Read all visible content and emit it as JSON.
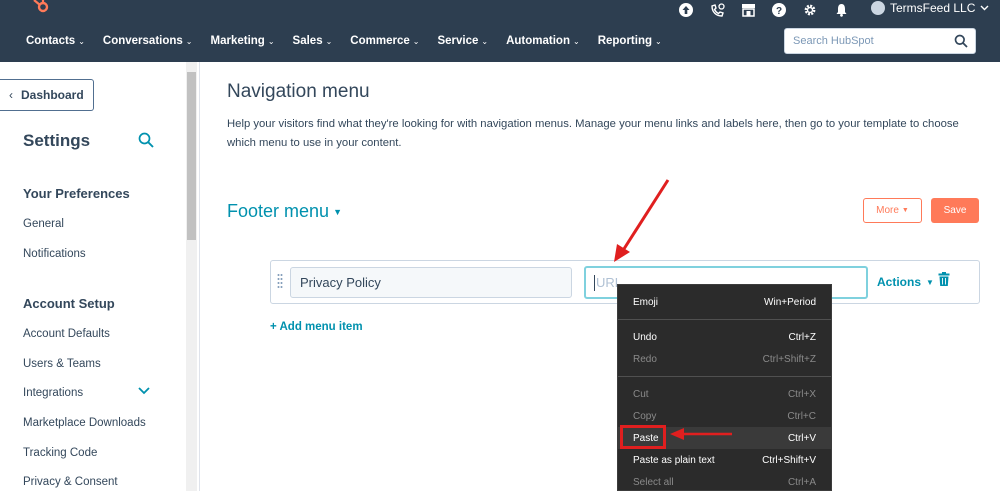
{
  "topbar": {
    "account_name": "TermsFeed LLC",
    "icons": [
      "upgrade-icon",
      "calling-icon",
      "marketplace-icon",
      "help-icon",
      "settings-gear-icon",
      "notifications-bell-icon"
    ]
  },
  "nav": {
    "items": [
      "Contacts",
      "Conversations",
      "Marketing",
      "Sales",
      "Commerce",
      "Service",
      "Automation",
      "Reporting"
    ],
    "search_placeholder": "Search HubSpot"
  },
  "sidebar": {
    "back_label": "Dashboard",
    "title": "Settings",
    "sections": [
      {
        "heading": "Your Preferences",
        "links": [
          "General",
          "Notifications"
        ]
      },
      {
        "heading": "Account Setup",
        "links": [
          "Account Defaults",
          "Users & Teams",
          "Integrations",
          "Marketplace Downloads",
          "Tracking Code",
          "Privacy & Consent"
        ]
      }
    ]
  },
  "main": {
    "title": "Navigation menu",
    "description": "Help your visitors find what they're looking for with navigation menus. Manage your menu links and labels here, then go to your template to choose which menu to use in your content.",
    "menu_name": "Footer menu",
    "more_label": "More",
    "save_label": "Save",
    "row": {
      "label_value": "Privacy Policy",
      "url_placeholder": "URL",
      "actions_label": "Actions"
    },
    "add_item_label": "+ Add menu item"
  },
  "context_menu": {
    "items": [
      {
        "label": "Emoji",
        "shortcut": "Win+Period"
      },
      {
        "label": "Undo",
        "shortcut": "Ctrl+Z"
      },
      {
        "label": "Redo",
        "shortcut": "Ctrl+Shift+Z"
      },
      {
        "label": "Cut",
        "shortcut": "Ctrl+X"
      },
      {
        "label": "Copy",
        "shortcut": "Ctrl+C"
      },
      {
        "label": "Paste",
        "shortcut": "Ctrl+V"
      },
      {
        "label": "Paste as plain text",
        "shortcut": "Ctrl+Shift+V"
      },
      {
        "label": "Select all",
        "shortcut": "Ctrl+A"
      }
    ]
  },
  "colors": {
    "nav_bg": "#2d3e50",
    "accent_teal": "#0091ae",
    "accent_orange": "#ff7a59",
    "annotation_red": "#e01f1f"
  }
}
